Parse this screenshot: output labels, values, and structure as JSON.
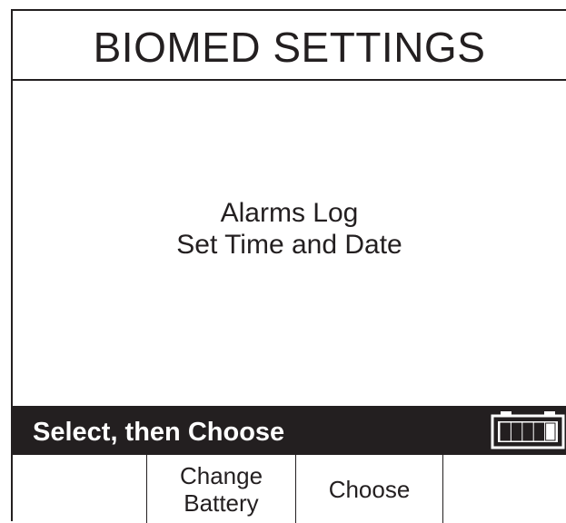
{
  "screen": {
    "title": "BIOMED SETTINGS"
  },
  "menu": {
    "items": [
      {
        "label": "Alarms Log"
      },
      {
        "label": "Set Time and Date"
      }
    ]
  },
  "status_bar": {
    "text": "Select, then Choose",
    "battery": {
      "icon": "battery-icon",
      "charge_bars_filled": 4,
      "charge_bars_total": 5
    }
  },
  "softkeys": [
    {
      "label": ""
    },
    {
      "label": "Change\nBattery"
    },
    {
      "label": "Choose"
    },
    {
      "label": ""
    }
  ],
  "colors": {
    "foreground": "#231f20",
    "background": "#ffffff",
    "status_bar_background": "#231f20",
    "status_bar_text": "#ffffff"
  }
}
